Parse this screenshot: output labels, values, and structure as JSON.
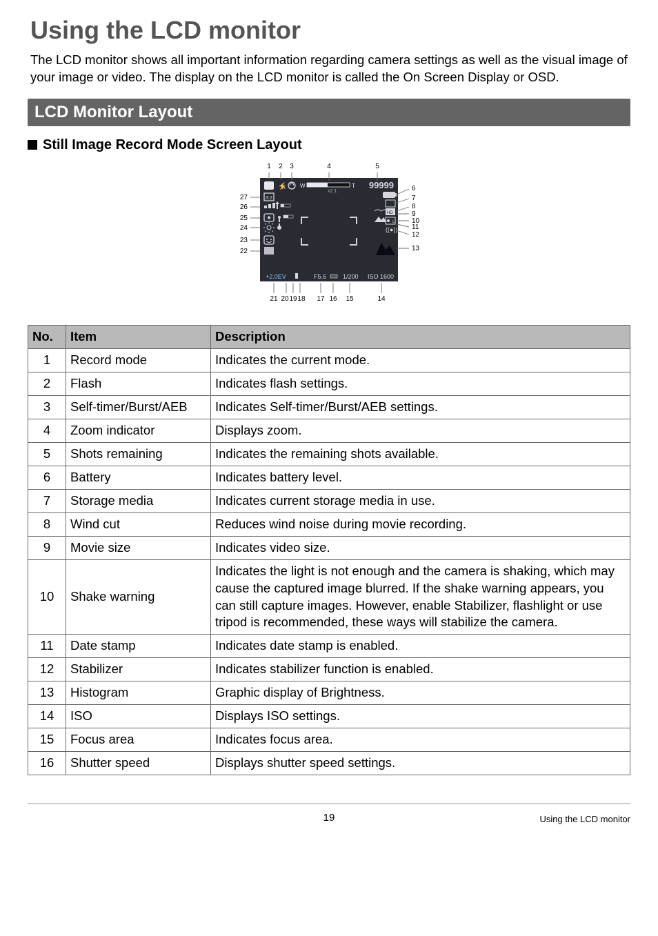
{
  "page": {
    "title": "Using the LCD monitor",
    "intro": "The LCD monitor shows all important information regarding camera settings as well as the visual image of your image or video. The display on the LCD monitor is called the On Screen Display or OSD.",
    "section_bar": "LCD Monitor Layout",
    "sub_heading": "Still Image Record Mode Screen Layout",
    "page_number": "19",
    "footer_right": "Using the LCD monitor"
  },
  "diagram": {
    "top_labels": [
      "1",
      "2",
      "3",
      "4",
      "5"
    ],
    "right_labels": [
      "6",
      "7",
      "8",
      "9",
      "10",
      "11",
      "12",
      "13"
    ],
    "left_labels": [
      "27",
      "26",
      "25",
      "24",
      "23",
      "22"
    ],
    "bottom_labels": [
      "21",
      "20",
      "19",
      "18",
      "17",
      "16",
      "15",
      "14"
    ],
    "osd_text": {
      "shots": "99999",
      "zoom": "x2.1",
      "ev": "+2.0EV",
      "fstop": "F5.6",
      "shutter": "1/200",
      "iso": "ISO 1600",
      "w": "W",
      "t": "T",
      "flash": "A"
    }
  },
  "table": {
    "headers": {
      "no": "No.",
      "item": "Item",
      "desc": "Description"
    },
    "rows": [
      {
        "no": "1",
        "item": "Record mode",
        "desc": "Indicates the current mode."
      },
      {
        "no": "2",
        "item": "Flash",
        "desc": "Indicates flash settings."
      },
      {
        "no": "3",
        "item": "Self-timer/Burst/AEB",
        "desc": "Indicates Self-timer/Burst/AEB settings."
      },
      {
        "no": "4",
        "item": "Zoom indicator",
        "desc": "Displays zoom."
      },
      {
        "no": "5",
        "item": "Shots remaining",
        "desc": "Indicates the remaining shots available."
      },
      {
        "no": "6",
        "item": "Battery",
        "desc": "Indicates battery level."
      },
      {
        "no": "7",
        "item": "Storage media",
        "desc": "Indicates current storage media in use."
      },
      {
        "no": "8",
        "item": "Wind cut",
        "desc": "Reduces wind noise during movie recording."
      },
      {
        "no": "9",
        "item": "Movie size",
        "desc": "Indicates video size."
      },
      {
        "no": "10",
        "item": "Shake warning",
        "desc": "Indicates the light is not enough and the camera is shaking, which may cause the captured image blurred. If the shake warning appears, you can still capture images. However, enable Stabilizer, flashlight or use tripod is recommended, these ways will stabilize the camera."
      },
      {
        "no": "11",
        "item": "Date stamp",
        "desc": "Indicates date stamp is enabled."
      },
      {
        "no": "12",
        "item": "Stabilizer",
        "desc": "Indicates stabilizer function is enabled."
      },
      {
        "no": "13",
        "item": "Histogram",
        "desc": "Graphic display of Brightness."
      },
      {
        "no": "14",
        "item": "ISO",
        "desc": "Displays ISO settings."
      },
      {
        "no": "15",
        "item": "Focus area",
        "desc": "Indicates focus area."
      },
      {
        "no": "16",
        "item": "Shutter speed",
        "desc": "Displays shutter speed settings."
      }
    ]
  }
}
